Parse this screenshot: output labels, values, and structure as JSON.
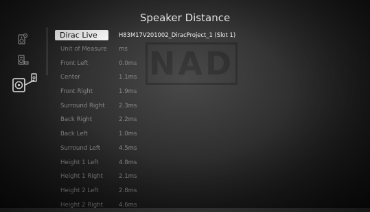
{
  "header": {
    "title": "Speaker Distance"
  },
  "watermark": {
    "text": "NAD"
  },
  "sidebar": {
    "icons": [
      {
        "name": "speaker-settings-icon"
      },
      {
        "name": "amplifier-icon"
      },
      {
        "name": "speaker-distance-icon"
      }
    ]
  },
  "settings": {
    "rows": [
      {
        "label": "Dirac Live",
        "value": "H83M17V201002_DiracProject_1 (Slot 1)"
      },
      {
        "label": "Unit of Measure",
        "value": "ms"
      },
      {
        "label": "Front Left",
        "value": "0.0ms"
      },
      {
        "label": "Center",
        "value": "1.1ms"
      },
      {
        "label": "Front Right",
        "value": "1.9ms"
      },
      {
        "label": "Surround Right",
        "value": "2.3ms"
      },
      {
        "label": "Back Right",
        "value": "2.2ms"
      },
      {
        "label": "Back Left",
        "value": "1.0ms"
      },
      {
        "label": "Surround Left",
        "value": "4.5ms"
      },
      {
        "label": "Height 1 Left",
        "value": "4.8ms"
      },
      {
        "label": "Height 1 Right",
        "value": "2.1ms"
      },
      {
        "label": "Height 2 Left",
        "value": "2.8ms"
      },
      {
        "label": "Height 2 Right",
        "value": "4.6ms"
      }
    ]
  }
}
